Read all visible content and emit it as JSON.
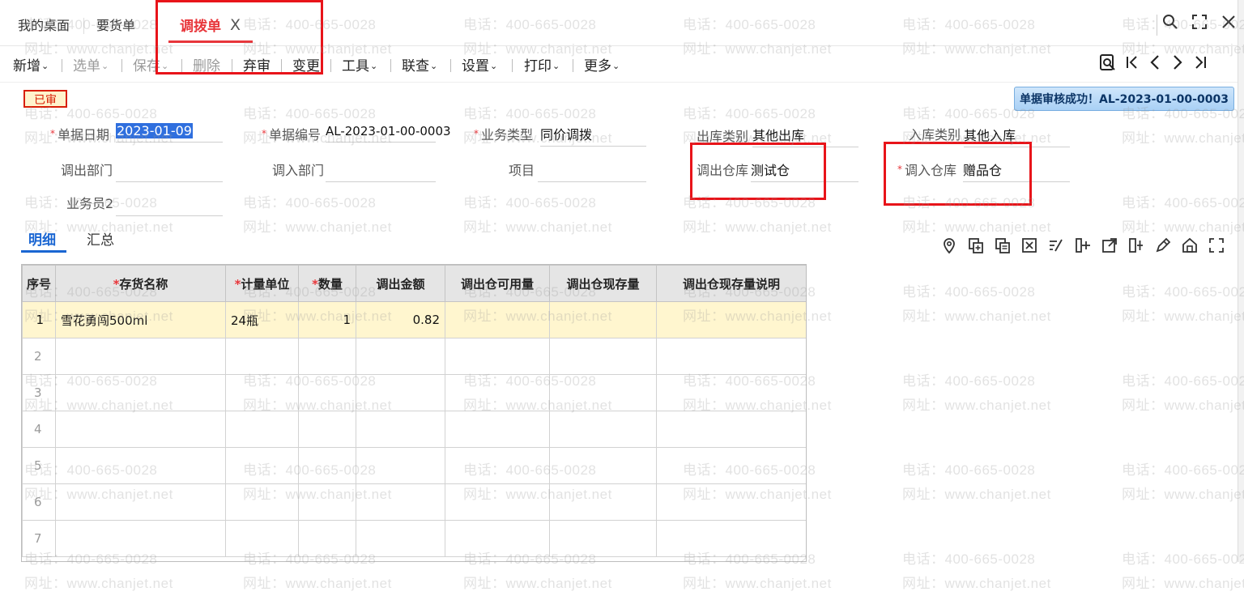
{
  "tabs": [
    {
      "label": "我的桌面"
    },
    {
      "label": "要货单"
    },
    {
      "label": "调拨单",
      "active": true
    }
  ],
  "tab_close_glyph": "X",
  "window_controls": [
    "search-icon",
    "fullscreen-icon",
    "close-icon"
  ],
  "toolbar": {
    "items": [
      {
        "label": "新增",
        "dropdown": true,
        "enabled": true
      },
      {
        "label": "选单",
        "dropdown": true,
        "enabled": false
      },
      {
        "label": "保存",
        "dropdown": true,
        "enabled": false
      },
      {
        "label": "删除",
        "dropdown": false,
        "enabled": false
      },
      {
        "label": "弃审",
        "dropdown": false,
        "enabled": true
      },
      {
        "label": "变更",
        "dropdown": false,
        "enabled": true
      },
      {
        "label": "工具",
        "dropdown": true,
        "enabled": true
      },
      {
        "label": "联查",
        "dropdown": true,
        "enabled": true
      },
      {
        "label": "设置",
        "dropdown": true,
        "enabled": true
      },
      {
        "label": "打印",
        "dropdown": true,
        "enabled": true
      },
      {
        "label": "更多",
        "dropdown": true,
        "enabled": true
      }
    ],
    "caret": "⌄",
    "nav_icons": [
      "search-doc-icon",
      "first-record-icon",
      "prev-record-icon",
      "next-record-icon",
      "last-record-icon"
    ]
  },
  "status_badge": "已审",
  "notice": "单据审核成功！AL-2023-01-00-0003",
  "form": {
    "doc_date": {
      "label": "单据日期",
      "value": "2023-01-09",
      "required": true
    },
    "doc_no": {
      "label": "单据编号",
      "value": "AL-2023-01-00-0003",
      "required": true
    },
    "biz_type": {
      "label": "业务类型",
      "value": "同价调拨",
      "required": true
    },
    "out_type": {
      "label": "出库类别",
      "value": "其他出库",
      "required": false
    },
    "in_type": {
      "label": "入库类别",
      "value": "其他入库",
      "required": false
    },
    "out_dept": {
      "label": "调出部门",
      "value": "",
      "required": false
    },
    "in_dept": {
      "label": "调入部门",
      "value": "",
      "required": false
    },
    "project": {
      "label": "项目",
      "value": "",
      "required": false
    },
    "out_wh": {
      "label": "调出仓库",
      "value": "测试仓",
      "required": false
    },
    "in_wh": {
      "label": "调入仓库",
      "value": "赠品仓",
      "required": true
    },
    "staff": {
      "label": "业务员2",
      "value": "",
      "required": false
    }
  },
  "subtabs": [
    {
      "label": "明细",
      "active": true
    },
    {
      "label": "汇总",
      "active": false
    }
  ],
  "grid_icons": [
    "location-icon",
    "copy-row-icon",
    "paste-row-icon",
    "delete-row-icon",
    "batch-edit-icon",
    "insert-column-icon",
    "export-icon",
    "split-icon",
    "edit-icon",
    "warehouse-icon",
    "expand-icon"
  ],
  "grid": {
    "columns": [
      {
        "label": "序号",
        "required": false
      },
      {
        "label": "存货名称",
        "required": true
      },
      {
        "label": "计量单位",
        "required": true
      },
      {
        "label": "数量",
        "required": true
      },
      {
        "label": "调出金额",
        "required": false
      },
      {
        "label": "调出仓可用量",
        "required": false
      },
      {
        "label": "调出仓现存量",
        "required": false
      },
      {
        "label": "调出仓现存量说明",
        "required": false
      }
    ],
    "rows": [
      {
        "seq": "1",
        "name": "雪花勇闯500ml",
        "unit": "24瓶",
        "qty": "1",
        "amount": "0.82",
        "avail": "",
        "stock": "",
        "stock_note": ""
      },
      {
        "seq": "2",
        "name": "",
        "unit": "",
        "qty": "",
        "amount": "",
        "avail": "",
        "stock": "",
        "stock_note": ""
      },
      {
        "seq": "3",
        "name": "",
        "unit": "",
        "qty": "",
        "amount": "",
        "avail": "",
        "stock": "",
        "stock_note": ""
      },
      {
        "seq": "4",
        "name": "",
        "unit": "",
        "qty": "",
        "amount": "",
        "avail": "",
        "stock": "",
        "stock_note": ""
      },
      {
        "seq": "5",
        "name": "",
        "unit": "",
        "qty": "",
        "amount": "",
        "avail": "",
        "stock": "",
        "stock_note": ""
      },
      {
        "seq": "6",
        "name": "",
        "unit": "",
        "qty": "",
        "amount": "",
        "avail": "",
        "stock": "",
        "stock_note": ""
      },
      {
        "seq": "7",
        "name": "",
        "unit": "",
        "qty": "",
        "amount": "",
        "avail": "",
        "stock": "",
        "stock_note": ""
      }
    ]
  },
  "watermark": {
    "phone": "电话：400-665-0028",
    "site": "网址：www.chanjet.net"
  },
  "colors": {
    "accent_red": "#e8363b",
    "active_blue": "#1a66d2",
    "highlight_row": "#fff6cf",
    "frame_red": "#e8141a"
  }
}
